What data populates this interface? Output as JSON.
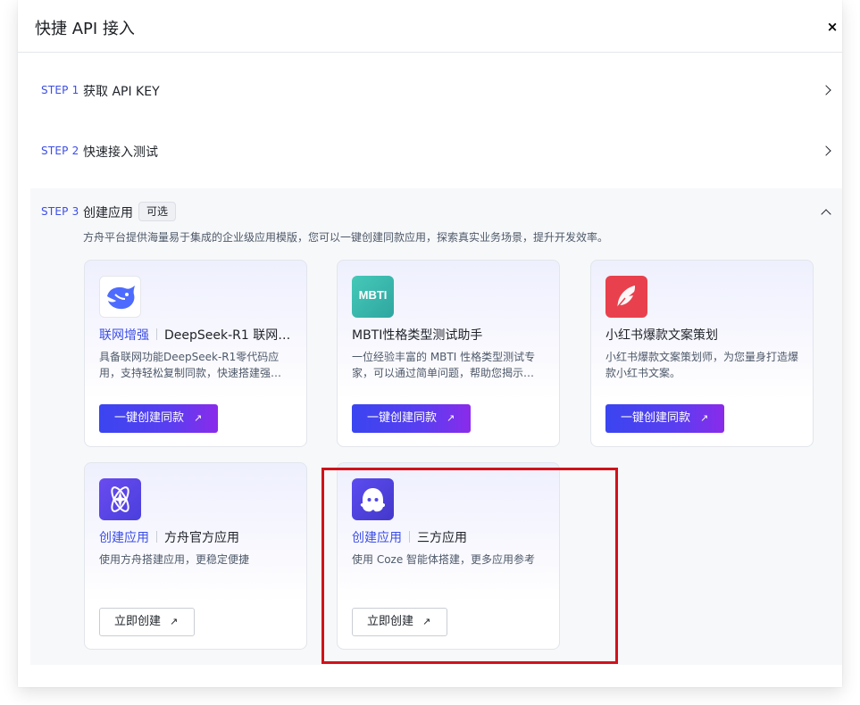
{
  "modal": {
    "title": "快捷 API 接入",
    "close_symbol": "×"
  },
  "steps": [
    {
      "tag": "STEP 1",
      "title": "获取 API KEY",
      "expanded": false
    },
    {
      "tag": "STEP 2",
      "title": "快速接入测试",
      "expanded": false
    },
    {
      "tag": "STEP 3",
      "title": "创建应用",
      "badge": "可选",
      "expanded": true,
      "description": "方舟平台提供海量易于集成的企业级应用模版，您可以一键创建同款应用，探索真实业务场景，提升开发效率。"
    }
  ],
  "template_cards": [
    {
      "icon": "deepseek-whale-icon",
      "icon_color": "#4d6bfe",
      "accent": "联网增强",
      "title": "DeepSeek-R1 联网…",
      "description": "具备联网功能DeepSeek-R1零代码应用，支持轻松复制同款，快速搭建强…",
      "button": "一键创建同款"
    },
    {
      "icon": "mbti-icon",
      "icon_text": "MBTI",
      "icon_color": "#3fbfb2",
      "accent": "",
      "title": "MBTI性格类型测试助手",
      "description": "一位经验丰富的 MBTI 性格类型测试专家，可以通过简单问题，帮助您揭示…",
      "button": "一键创建同款"
    },
    {
      "icon": "feather-icon",
      "icon_color": "#e8414d",
      "accent": "",
      "title": "小红书爆款文案策划",
      "description": "小红书爆款文案策划师，为您量身打造爆款小红书文案。",
      "button": "一键创建同款"
    }
  ],
  "create_cards": [
    {
      "icon": "atom-icon",
      "icon_color": "#5a47e8",
      "accent": "创建应用",
      "title": "方舟官方应用",
      "description": "使用方舟搭建应用，更稳定便捷",
      "button": "立即创建"
    },
    {
      "icon": "coze-ghost-icon",
      "icon_color": "#4f46e5",
      "accent": "创建应用",
      "title": "三方应用",
      "description": "使用 Coze 智能体搭建，更多应用参考",
      "button": "立即创建"
    }
  ],
  "arrow_symbol": "↗",
  "highlight_color": "#d0121b"
}
